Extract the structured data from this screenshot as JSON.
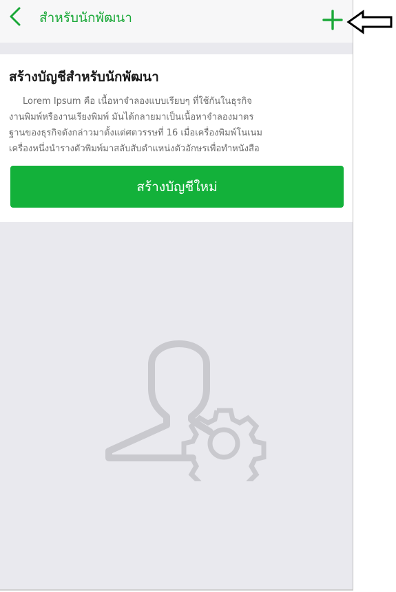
{
  "nav": {
    "title": "สำหรับนักพัฒนา",
    "back_icon": "chevron-left-icon",
    "add_icon": "plus-icon"
  },
  "card": {
    "title": "สร้างบัญชีสำหรับนักพัฒนา",
    "description_lines": [
      "Lorem Ipsum คือ เนื้อหาจำลองแบบเรียบๆ ที่ใช้กันในธุรกิจ",
      "งานพิมพ์หรืองานเรียงพิมพ์ มันได้กลายมาเป็นเนื้อหาจำลองมาตร",
      "ฐานของธุรกิจดังกล่าวมาตั้งแต่ศตวรรษที่ 16 เมื่อเครื่องพิมพ์โนเนม",
      "เครื่องหนึ่งนำรางตัวพิมพ์มาสลับสับตำแหน่งตัวอักษรเพื่อทำหนังสือ"
    ],
    "create_button_label": "สร้างบัญชีใหม่"
  },
  "empty_state": {
    "icon": "user-settings-icon"
  },
  "annotation": {
    "icon": "left-arrow-icon"
  },
  "colors": {
    "accent": "#13b13a",
    "nav_text": "#1aa838",
    "background": "#e9e9ee",
    "illustration": "#c9c9ce"
  }
}
